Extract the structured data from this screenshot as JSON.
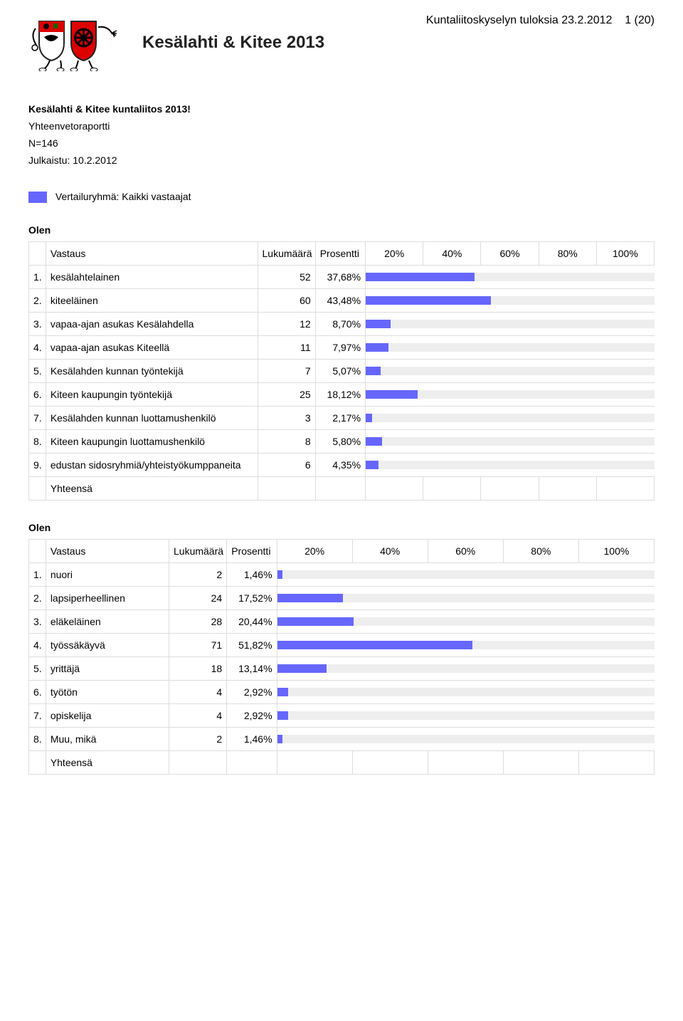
{
  "header": {
    "site_title": "Kesälahti & Kitee 2013",
    "right_text": "Kuntaliitoskyselyn tuloksia 23.2.2012",
    "page_indicator": "1 (20)"
  },
  "survey": {
    "title": "Kesälahti & Kitee kuntaliitos 2013!",
    "report_label": "Yhteenvetoraportti",
    "n_label": "N=146",
    "published_label": "Julkaistu: 10.2.2012",
    "group_label": "Vertailuryhmä: Kaikki vastaajat"
  },
  "table_headers": {
    "response": "Vastaus",
    "count": "Lukumäärä",
    "percent": "Prosentti",
    "steps": [
      "20%",
      "40%",
      "60%",
      "80%",
      "100%"
    ],
    "total": "Yhteensä"
  },
  "chart_data": [
    {
      "type": "bar",
      "title": "Olen",
      "xlabel": "",
      "ylabel": "Prosentti",
      "ylim": [
        0,
        100
      ],
      "rows": [
        {
          "idx": "1.",
          "label": "kesälahtelainen",
          "count": 52,
          "pct": 37.68
        },
        {
          "idx": "2.",
          "label": "kiteeläinen",
          "count": 60,
          "pct": 43.48
        },
        {
          "idx": "3.",
          "label": "vapaa-ajan asukas Kesälahdella",
          "count": 12,
          "pct": 8.7
        },
        {
          "idx": "4.",
          "label": "vapaa-ajan asukas Kiteellä",
          "count": 11,
          "pct": 7.97
        },
        {
          "idx": "5.",
          "label": "Kesälahden kunnan työntekijä",
          "count": 7,
          "pct": 5.07
        },
        {
          "idx": "6.",
          "label": "Kiteen kaupungin työntekijä",
          "count": 25,
          "pct": 18.12
        },
        {
          "idx": "7.",
          "label": "Kesälahden kunnan luottamushenkilö",
          "count": 3,
          "pct": 2.17
        },
        {
          "idx": "8.",
          "label": "Kiteen kaupungin luottamushenkilö",
          "count": 8,
          "pct": 5.8
        },
        {
          "idx": "9.",
          "label": "edustan sidosryhmiä/yhteistyökumppaneita",
          "count": 6,
          "pct": 4.35
        }
      ]
    },
    {
      "type": "bar",
      "title": "Olen",
      "xlabel": "",
      "ylabel": "Prosentti",
      "ylim": [
        0,
        100
      ],
      "rows": [
        {
          "idx": "1.",
          "label": "nuori",
          "count": 2,
          "pct": 1.46
        },
        {
          "idx": "2.",
          "label": "lapsiperheellinen",
          "count": 24,
          "pct": 17.52
        },
        {
          "idx": "3.",
          "label": "eläkeläinen",
          "count": 28,
          "pct": 20.44
        },
        {
          "idx": "4.",
          "label": "työssäkäyvä",
          "count": 71,
          "pct": 51.82
        },
        {
          "idx": "5.",
          "label": "yrittäjä",
          "count": 18,
          "pct": 13.14
        },
        {
          "idx": "6.",
          "label": "työtön",
          "count": 4,
          "pct": 2.92
        },
        {
          "idx": "7.",
          "label": "opiskelija",
          "count": 4,
          "pct": 2.92
        },
        {
          "idx": "8.",
          "label": "Muu, mikä",
          "count": 2,
          "pct": 1.46
        }
      ]
    }
  ]
}
